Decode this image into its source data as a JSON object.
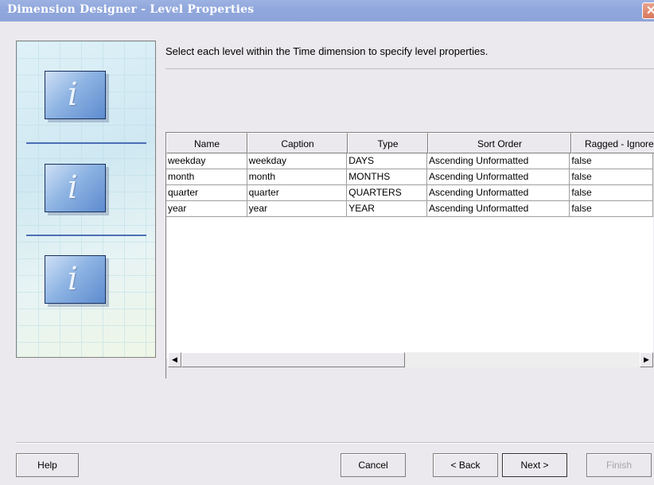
{
  "window": {
    "title": "Dimension Designer - Level Properties"
  },
  "instruction": "Select each level within the Time dimension to specify level properties.",
  "icons": {
    "panel": [
      "info-icon",
      "info-icon",
      "info-icon"
    ],
    "close": "close-icon",
    "glyph": "i"
  },
  "table": {
    "columns": [
      "Name",
      "Caption",
      "Type",
      "Sort Order",
      "Ragged - Ignore"
    ],
    "rows": [
      [
        "weekday",
        "weekday",
        "DAYS",
        "Ascending Unformatted",
        "false"
      ],
      [
        "month",
        "month",
        "MONTHS",
        "Ascending Unformatted",
        "false"
      ],
      [
        "quarter",
        "quarter",
        "QUARTERS",
        "Ascending Unformatted",
        "false"
      ],
      [
        "year",
        "year",
        "YEAR",
        "Ascending Unformatted",
        "false"
      ]
    ]
  },
  "buttons": {
    "help": "Help",
    "cancel": "Cancel",
    "back": "< Back",
    "next": "Next >",
    "finish": "Finish"
  },
  "colors": {
    "title_bar": "#90a7dc",
    "dialog_bg": "#ebe9ed",
    "close": "#d8775c"
  }
}
